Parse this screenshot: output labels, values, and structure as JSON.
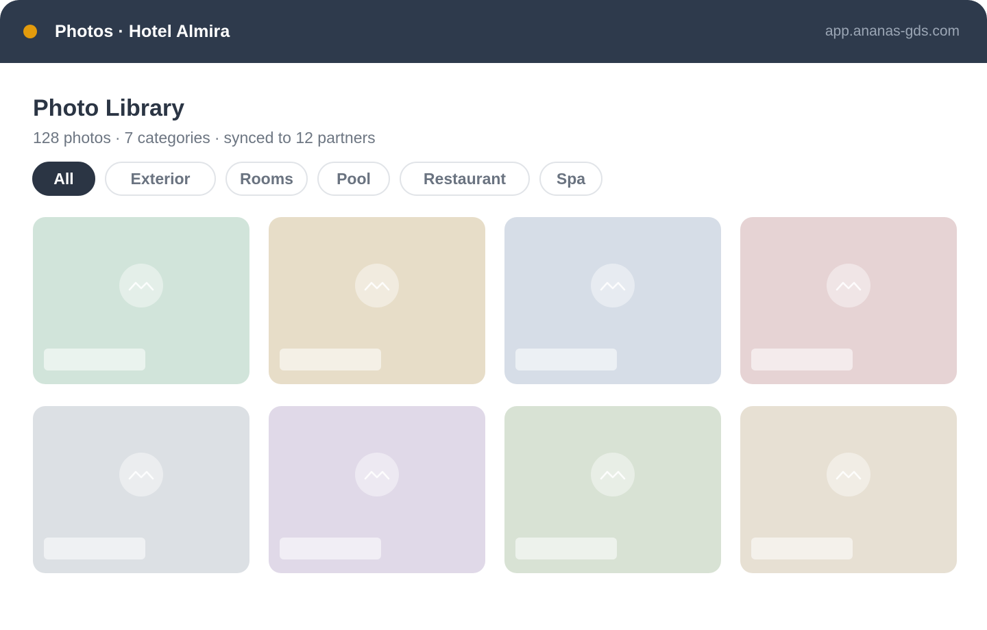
{
  "window": {
    "title": "Photos · Hotel Almira",
    "url": "app.ananas-gds.com",
    "status_color": "#e39b0c"
  },
  "page": {
    "title": "Photo Library",
    "stats": {
      "photos": "128 photos",
      "categories": "7 categories",
      "sync": "synced to 12 partners",
      "separator": "·"
    }
  },
  "filters": [
    {
      "label": "All",
      "active": true
    },
    {
      "label": "Exterior",
      "active": false
    },
    {
      "label": "Rooms",
      "active": false
    },
    {
      "label": "Pool",
      "active": false
    },
    {
      "label": "Restaurant",
      "active": false
    },
    {
      "label": "Spa",
      "active": false
    }
  ],
  "photos": [
    {
      "icon": "image-placeholder-icon",
      "color": "#d1e4da"
    },
    {
      "icon": "image-placeholder-icon",
      "color": "#e7ddc8"
    },
    {
      "icon": "image-placeholder-icon",
      "color": "#d6dde7"
    },
    {
      "icon": "image-placeholder-icon",
      "color": "#e6d3d4"
    },
    {
      "icon": "image-placeholder-icon",
      "color": "#dce0e4"
    },
    {
      "icon": "image-placeholder-icon",
      "color": "#e0d9e8"
    },
    {
      "icon": "image-placeholder-icon",
      "color": "#d8e2d4"
    },
    {
      "icon": "image-placeholder-icon",
      "color": "#e7e0d3"
    }
  ]
}
